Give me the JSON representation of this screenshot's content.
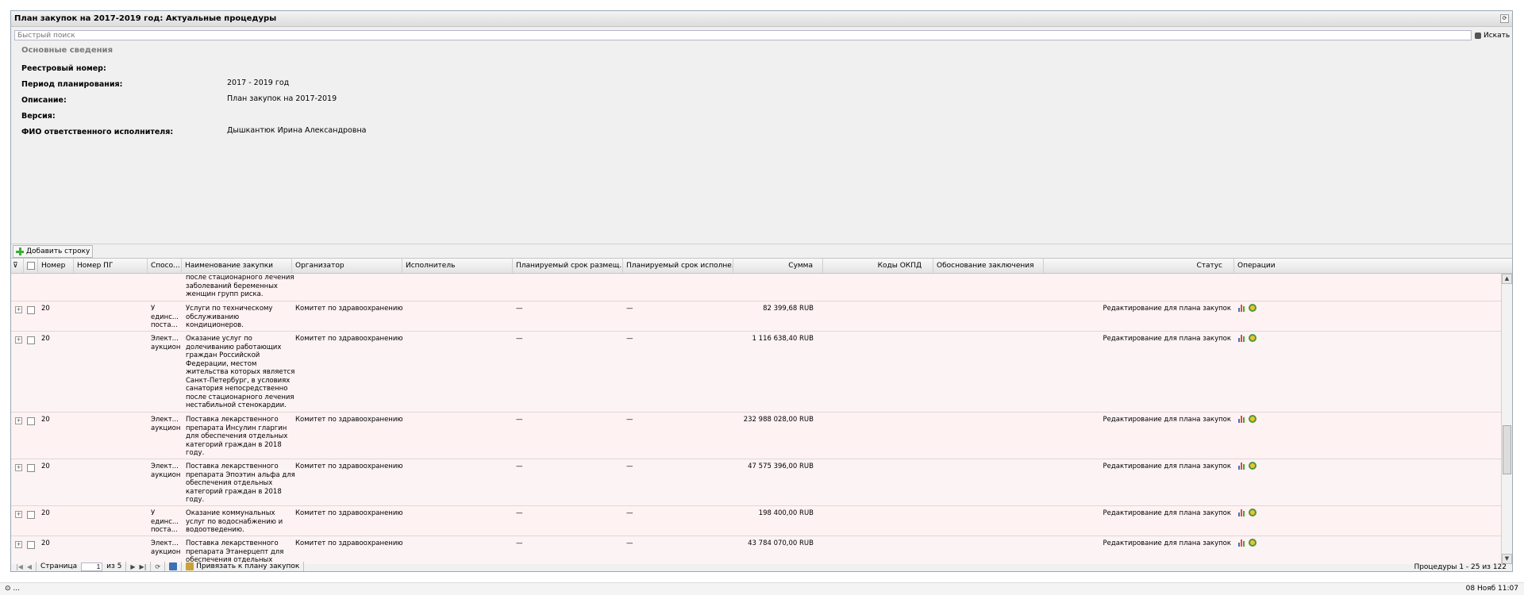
{
  "window": {
    "title": "План закупок на 2017-2019 год: Актуальные процедуры"
  },
  "search": {
    "placeholder": "Быстрый поиск",
    "button": "Искать"
  },
  "info": {
    "legend": "Основные сведения",
    "fields": [
      {
        "label": "Реестровый номер:",
        "value": ""
      },
      {
        "label": "Период планирования:",
        "value": "2017 - 2019 год"
      },
      {
        "label": "Описание:",
        "value": "План закупок на 2017-2019"
      },
      {
        "label": "Версия:",
        "value": ""
      },
      {
        "label": "ФИО ответственного исполнителя:",
        "value": "Дышкантюк Ирина Александровна"
      }
    ]
  },
  "toolbar": {
    "add_row": "Добавить строку"
  },
  "grid": {
    "columns": [
      "Номер",
      "Номер ПГ",
      "Спосо...",
      "Наименование закупки",
      "Организатор",
      "Исполнитель",
      "Планируемый срок размещ...",
      "Планируемый срок исполне...",
      "Сумма",
      "Коды ОКПД",
      "Обоснование заключения",
      "Статус",
      "Операции"
    ],
    "partial_row": {
      "name": "после стационарного лечения\nзаболеваний беременных\nженщин групп риска."
    },
    "rows": [
      {
        "number": "20",
        "method": "У\nединс...\nпоста...",
        "name": "Услуги по техническому\nобслуживанию\nкондиционеров.",
        "organizer": "Комитет по здравоохранению",
        "term_place": "—",
        "term_exec": "—",
        "sum": "82 399,68 RUB",
        "status": "Редактирование для плана закупок"
      },
      {
        "number": "20",
        "method": "Элект...\nаукцион",
        "name": "Оказание услуг по\nдолечиванию работающих\nграждан Российской\nФедерации, местом\nжительства которых является\nСанкт-Петербург, в условиях\nсанатория непосредственно\nпосле стационарного лечения\nнестабильной стенокардии.",
        "organizer": "Комитет по здравоохранению",
        "term_place": "—",
        "term_exec": "—",
        "sum": "1 116 638,40 RUB",
        "status": "Редактирование для плана закупок"
      },
      {
        "number": "20",
        "method": "Элект...\nаукцион",
        "name": "Поставка лекарственного\nпрепарата Инсулин гларгин\nдля обеспечения отдельных\nкатегорий граждан в 2018\nгоду.",
        "organizer": "Комитет по здравоохранению",
        "term_place": "—",
        "term_exec": "—",
        "sum": "232 988 028,00 RUB",
        "status": "Редактирование для плана закупок"
      },
      {
        "number": "20",
        "method": "Элект...\nаукцион",
        "name": "Поставка лекарственного\nпрепарата Эпоэтин альфа для\nобеспечения отдельных\nкатегорий граждан в 2018\nгоду.",
        "organizer": "Комитет по здравоохранению",
        "term_place": "—",
        "term_exec": "—",
        "sum": "47 575 396,00 RUB",
        "status": "Редактирование для плана закупок"
      },
      {
        "number": "20",
        "method": "У\nединс...\nпоста...",
        "name": "Оказание коммунальных\nуслуг по водоснабжению и\nводоотведению.",
        "organizer": "Комитет по здравоохранению",
        "term_place": "—",
        "term_exec": "—",
        "sum": "198 400,00 RUB",
        "status": "Редактирование для плана закупок"
      },
      {
        "number": "20",
        "method": "Элект...\nаукцион",
        "name": "Поставка лекарственного\nпрепарата Этанерцепт для\nобеспечения отдельных",
        "organizer": "Комитет по здравоохранению",
        "term_place": "—",
        "term_exec": "—",
        "sum": "43 784 070,00 RUB",
        "status": "Редактирование для плана закупок"
      }
    ]
  },
  "pager": {
    "page_label": "Страница",
    "page": "1",
    "of_label": "из 5",
    "bind_button": "Привязать к плану закупок",
    "summary": "Процедуры 1 - 25 из 122"
  },
  "statusbar": {
    "left": "...",
    "datetime": "08 Нояб 11:07"
  },
  "colors": {
    "row_bg": "#fff2f3",
    "header_bg": "#e3e3e3",
    "add_icon": "#3cae33"
  }
}
